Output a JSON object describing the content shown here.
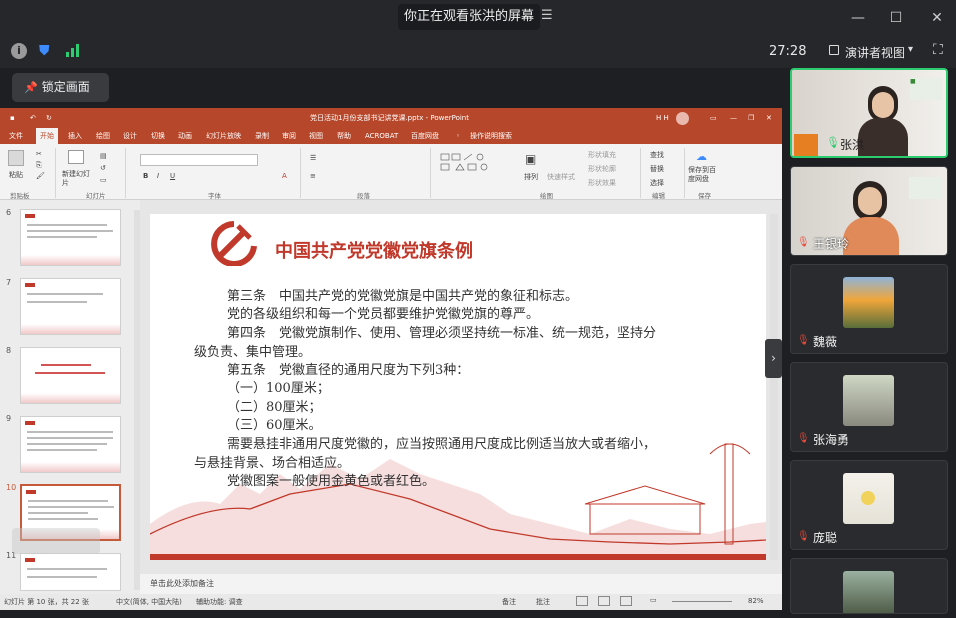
{
  "window": {
    "title": "你正在观看张洪的屏幕",
    "menu_icon": "menu-icon",
    "min_label": "—",
    "max_label": "☐",
    "close_label": "✕"
  },
  "toolbar": {
    "timer": "27:28",
    "presenter_view": "演讲者视图",
    "lock_button": "锁定画面"
  },
  "ppt": {
    "file_title": "党日活动1月份支部书记讲党课.pptx - PowerPoint",
    "user_initials": "H H",
    "tabs": [
      "文件",
      "开始",
      "插入",
      "绘图",
      "设计",
      "切换",
      "动画",
      "幻灯片放映",
      "录制",
      "审阅",
      "视图",
      "帮助",
      "ACROBAT",
      "百度网盘",
      "操作说明搜索"
    ],
    "active_tab": "开始",
    "ribbon_groups": [
      "剪贴板",
      "幻灯片",
      "字体",
      "段落",
      "绘图",
      "编辑",
      "保存"
    ],
    "ribbon_items": {
      "paste": "粘贴",
      "new_slide": "新建幻灯片",
      "arrange": "排列",
      "quick_style": "快速样式",
      "shape_fill": "形状填充",
      "shape_outline": "形状轮廓",
      "shape_effect": "形状效果",
      "find": "查找",
      "replace": "替换",
      "select": "选择",
      "save_baidu": "保存到百度网盘"
    },
    "thumbnail_numbers": [
      "6",
      "7",
      "8",
      "9",
      "10",
      "11"
    ],
    "selected_slide": "10",
    "slide": {
      "title": "中国共产党党徽党旗条例",
      "lines": [
        "第三条　中国共产党的党徽党旗是中国共产党的象征和标志。",
        "党的各级组织和每一个党员都要维护党徽党旗的尊严。",
        "第四条　党徽党旗制作、使用、管理必须坚持统一标准、统一规范，坚持分",
        "级负责、集中管理。",
        "第五条　党徽直径的通用尺度为下列3种：",
        "（一）100厘米；",
        "（二）80厘米；",
        "（三）60厘米。",
        "需要悬挂非通用尺度党徽的，应当按照通用尺度成比例适当放大或者缩小，",
        "与悬挂背景、场合相适应。",
        "党徽图案一般使用金黄色或者红色。"
      ]
    },
    "notes_placeholder": "单击此处添加备注",
    "status": {
      "slide_count": "幻灯片 第 10 张，共 22 张",
      "language": "中文(简体, 中国大陆)",
      "accessibility": "辅助功能: 调查",
      "notes": "备注",
      "comments": "批注",
      "zoom": "82%"
    }
  },
  "participants": [
    {
      "name": "张洪",
      "active": true,
      "mic": "on"
    },
    {
      "name": "王银玲",
      "active": false,
      "mic": "muted"
    },
    {
      "name": "魏薇",
      "active": false,
      "mic": "muted"
    },
    {
      "name": "张海勇",
      "active": false,
      "mic": "muted"
    },
    {
      "name": "庞聪",
      "active": false,
      "mic": "muted"
    },
    {
      "name": "",
      "active": false,
      "mic": "muted"
    }
  ],
  "colors": {
    "ppt_red": "#b7472a",
    "party_red": "#c0392b",
    "active_green": "#2ecc71"
  }
}
